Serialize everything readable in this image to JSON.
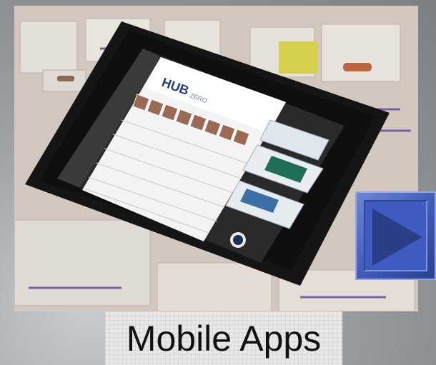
{
  "caption": "Mobile Apps",
  "tablet": {
    "logo": "HUB",
    "logo_suffix": "ZERO",
    "avatar_count": 8,
    "list_rows": 8,
    "video_cards": 3
  },
  "play_button": {
    "icon": "play-triangle-icon",
    "color": "#3f5ac0"
  },
  "colors": {
    "caption_text": "#111111",
    "tablet_frame": "#1a1a1a",
    "photo_background": "#cdbfb4"
  }
}
